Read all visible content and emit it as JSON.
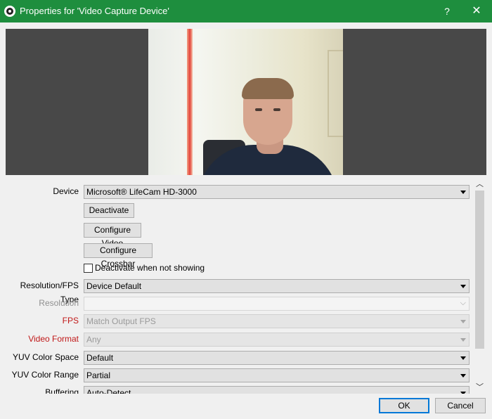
{
  "window": {
    "title": "Properties for 'Video Capture Device'",
    "help_label": "?",
    "close_label": "✕"
  },
  "form": {
    "device": {
      "label": "Device",
      "value": "Microsoft® LifeCam HD-3000"
    },
    "deactivate_button": "Deactivate",
    "configure_video_button": "Configure Video",
    "configure_crossbar_button": "Configure Crossbar",
    "deactivate_when_not_showing": {
      "label": "Deactivate when not showing",
      "checked": false
    },
    "resolution_fps_type": {
      "label": "Resolution/FPS Type",
      "value": "Device Default"
    },
    "resolution": {
      "label": "Resolution",
      "value": ""
    },
    "fps": {
      "label": "FPS",
      "value": "Match Output FPS"
    },
    "video_format": {
      "label": "Video Format",
      "value": "Any"
    },
    "yuv_color_space": {
      "label": "YUV Color Space",
      "value": "Default"
    },
    "yuv_color_range": {
      "label": "YUV Color Range",
      "value": "Partial"
    },
    "buffering": {
      "label": "Buffering",
      "value": "Auto-Detect"
    }
  },
  "footer": {
    "ok_label": "OK",
    "cancel_label": "Cancel"
  },
  "colors": {
    "titlebar": "#1e8e3e",
    "preview_bg": "#484848",
    "error_label": "#c01818"
  }
}
